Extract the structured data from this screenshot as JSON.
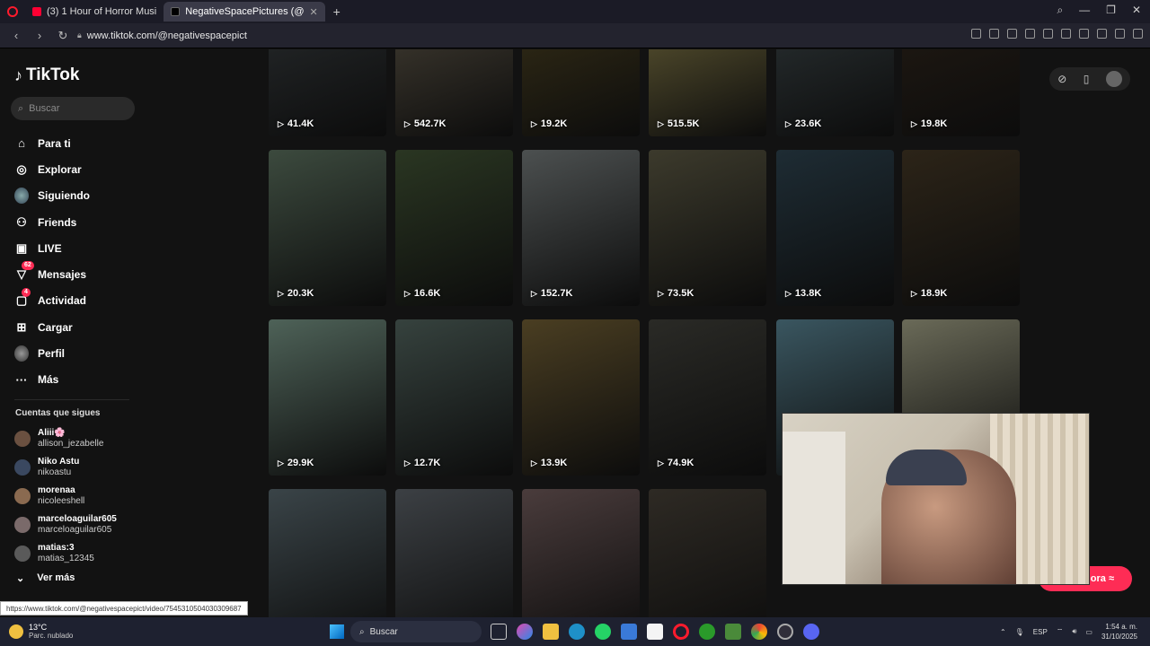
{
  "browser": {
    "tabs": [
      {
        "title": "(3) 1 Hour of Horror Musi",
        "active": false,
        "favicon_color": "#ff0033"
      },
      {
        "title": "NegativeSpacePictures (@",
        "active": true,
        "favicon_color": "#000000"
      }
    ],
    "url": "www.tiktok.com/@negativespacepict",
    "status_url": "https://www.tiktok.com/@negativespacepict/video/7545310504030309687"
  },
  "tiktok": {
    "logo": "TikTok",
    "search_placeholder": "Buscar",
    "menu": [
      {
        "label": "Para ti",
        "icon": "home-icon",
        "glyph": "⌂"
      },
      {
        "label": "Explorar",
        "icon": "compass-icon",
        "glyph": "◎"
      },
      {
        "label": "Siguiendo",
        "icon": "following-avatar-icon",
        "glyph": ""
      },
      {
        "label": "Friends",
        "icon": "friends-icon",
        "glyph": "⚇"
      },
      {
        "label": "LIVE",
        "icon": "live-icon",
        "glyph": "▣"
      },
      {
        "label": "Mensajes",
        "icon": "messages-icon",
        "glyph": "▽",
        "badge": "62"
      },
      {
        "label": "Actividad",
        "icon": "activity-icon",
        "glyph": "▢",
        "badge": "4"
      },
      {
        "label": "Cargar",
        "icon": "upload-icon",
        "glyph": "⊞"
      },
      {
        "label": "Perfil",
        "icon": "profile-avatar-icon",
        "glyph": ""
      },
      {
        "label": "Más",
        "icon": "more-icon",
        "glyph": "···"
      }
    ],
    "following_heading": "Cuentas que sigues",
    "following": [
      {
        "name": "Aliii🌸",
        "user": "allison_jezabelle"
      },
      {
        "name": "Niko Astu",
        "user": "nikoastu"
      },
      {
        "name": "morenaa",
        "user": "nicoleeshell"
      },
      {
        "name": "marceloaguilar605",
        "user": "marceloaguilar605"
      },
      {
        "name": "matias:3",
        "user": "matias_12345"
      }
    ],
    "see_more": "Ver más",
    "videos": [
      {
        "views": "41.4K",
        "bg": "#2a2e30"
      },
      {
        "views": "542.7K",
        "bg": "#4a4438"
      },
      {
        "views": "19.2K",
        "bg": "#3a3218"
      },
      {
        "views": "515.5K",
        "bg": "#6a6238"
      },
      {
        "views": "23.6K",
        "bg": "#2e3638"
      },
      {
        "views": "19.8K",
        "bg": "#241c14"
      },
      {
        "views": "20.3K",
        "bg": "#3c4a3e"
      },
      {
        "views": "16.6K",
        "bg": "#2a3622"
      },
      {
        "views": "152.7K",
        "bg": "#4c5050"
      },
      {
        "views": "73.5K",
        "bg": "#3c3a2c"
      },
      {
        "views": "13.8K",
        "bg": "#1e2c34"
      },
      {
        "views": "18.9K",
        "bg": "#2c2418"
      },
      {
        "views": "29.9K",
        "bg": "#4e6258"
      },
      {
        "views": "12.7K",
        "bg": "#36423e"
      },
      {
        "views": "13.9K",
        "bg": "#4a3e22"
      },
      {
        "views": "74.9K",
        "bg": "#2a2a26"
      },
      {
        "views": "",
        "bg": "#3a5660"
      },
      {
        "views": "",
        "bg": "#6a6a58"
      },
      {
        "views": "",
        "bg": "#3a4448"
      },
      {
        "views": "",
        "bg": "#3c4044"
      },
      {
        "views": "",
        "bg": "#4a3c3c"
      },
      {
        "views": "",
        "bg": "#2e2a24"
      }
    ],
    "cta_label": "ora ≈"
  },
  "taskbar": {
    "temp": "13°C",
    "weather": "Parc. nublado",
    "search": "Buscar",
    "lang": "ESP",
    "time": "1:54 a. m.",
    "date": "31/10/2025"
  }
}
